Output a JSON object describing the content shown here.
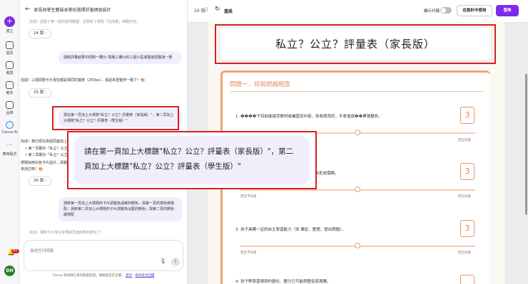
{
  "rail": {
    "create": "建立",
    "items": [
      {
        "label": "首頁",
        "icon": "home-icon"
      },
      {
        "label": "專案",
        "icon": "folder-icon"
      },
      {
        "label": "範本",
        "icon": "template-icon"
      },
      {
        "label": "品牌",
        "icon": "brand-icon"
      },
      {
        "label": "Canva AI",
        "icon": "canva-ai-icon"
      },
      {
        "label": "應用程式",
        "icon": "apps-icon"
      }
    ],
    "notif_count": "9+",
    "avatar": "DH"
  },
  "chat": {
    "title": "家長與學生雙語本學校選擇評量網頁設計",
    "top_fragment": "完成！調整了第一題的選項範圍，並更新了標題「完成度」相關內容。",
    "pill_24": "24 版",
    "msg_user_1": "請將評量結果中問題一欄分–問題三欄分的三個小區域寬度調整為一致",
    "msg_bot_1": "完成！三個問題卡片現在都是相同的寬度（250px），看起來更整齊一致了！🎨",
    "pill_25": "25 版",
    "msg_user_2": "請在第一頁加上大標題\"私立？公立？評量表（家長版）\"，第二頁加上大標題\"私立？公立？評量表（學生版）\"",
    "msg_bot_2_a": "完成！我已經在兩個頁面加上了大標題：",
    "msg_bot_2_b": "• 第一頁顯示「私立？公立？評量表（家長版）」",
    "msg_bot_2_c": "• 第二頁顯示「私立？公立？評量表（學生版）」",
    "msg_bot_2_d": "標題採用白色卡片設計，與整體風格一致，看起",
    "msg_bot_2_e": "來自訂睛！🎨",
    "pill_26": "26 版",
    "msg_user_3": "請將第一頁加上大標題的卡片調整為溫暖的顏色，與第一頁的標色做搭配；請將第二頁加上大標題的卡片調整為淡藍的顏色，與第二頁的顏色做搭配",
    "bottom_fragment": "完成！標題卡片現在會根據頁面的顏色變化了：",
    "input_placeholder": "描述任何問題",
    "footer_text": "Canva 程式碼工具可能會犯錯，請檢查是否正確。",
    "footer_link_1": "意見",
    "footer_link_2": "提供意見回饋"
  },
  "topbar": {
    "page_count": "26 版",
    "reset": "重設",
    "code_label": "顯示代碼",
    "use_design": "在設計中使用",
    "publish": "發佈"
  },
  "canvas": {
    "title": "私立？公立？評量表（家長版）",
    "section_title": "問題一．目前超越程度",
    "q1": "1. ����子目前能接受教材或補習班內容，吸收度良好，不會造成��累積壓折。",
    "q2": "2. 孩子的學習態度積極、主動，不需因嚴度而抗拒或撐賴。",
    "q3": "3. 孩子具備一定的自主學習能力（如 筆記、整理、提出問題）。",
    "q4": "4. 孩子對學習環境的變化、壓力已可能調整從容適應。",
    "score_1": "3",
    "score_2": "3",
    "score_3": "3",
    "scale_min": "完全不同意",
    "scale_max": "完全同意",
    "answers": [
      3,
      3,
      3
    ]
  },
  "zoom": {
    "text": "請在第一頁加上大標題\"私立？公立？評量表（家長版）\"，第二頁加上大標題\"私立？公立？評量表（學生版）\""
  },
  "colors": {
    "accent": "#7d2ae8",
    "section": "#e8885a",
    "highlight": "#d32121",
    "bubble": "#f1eefc"
  }
}
